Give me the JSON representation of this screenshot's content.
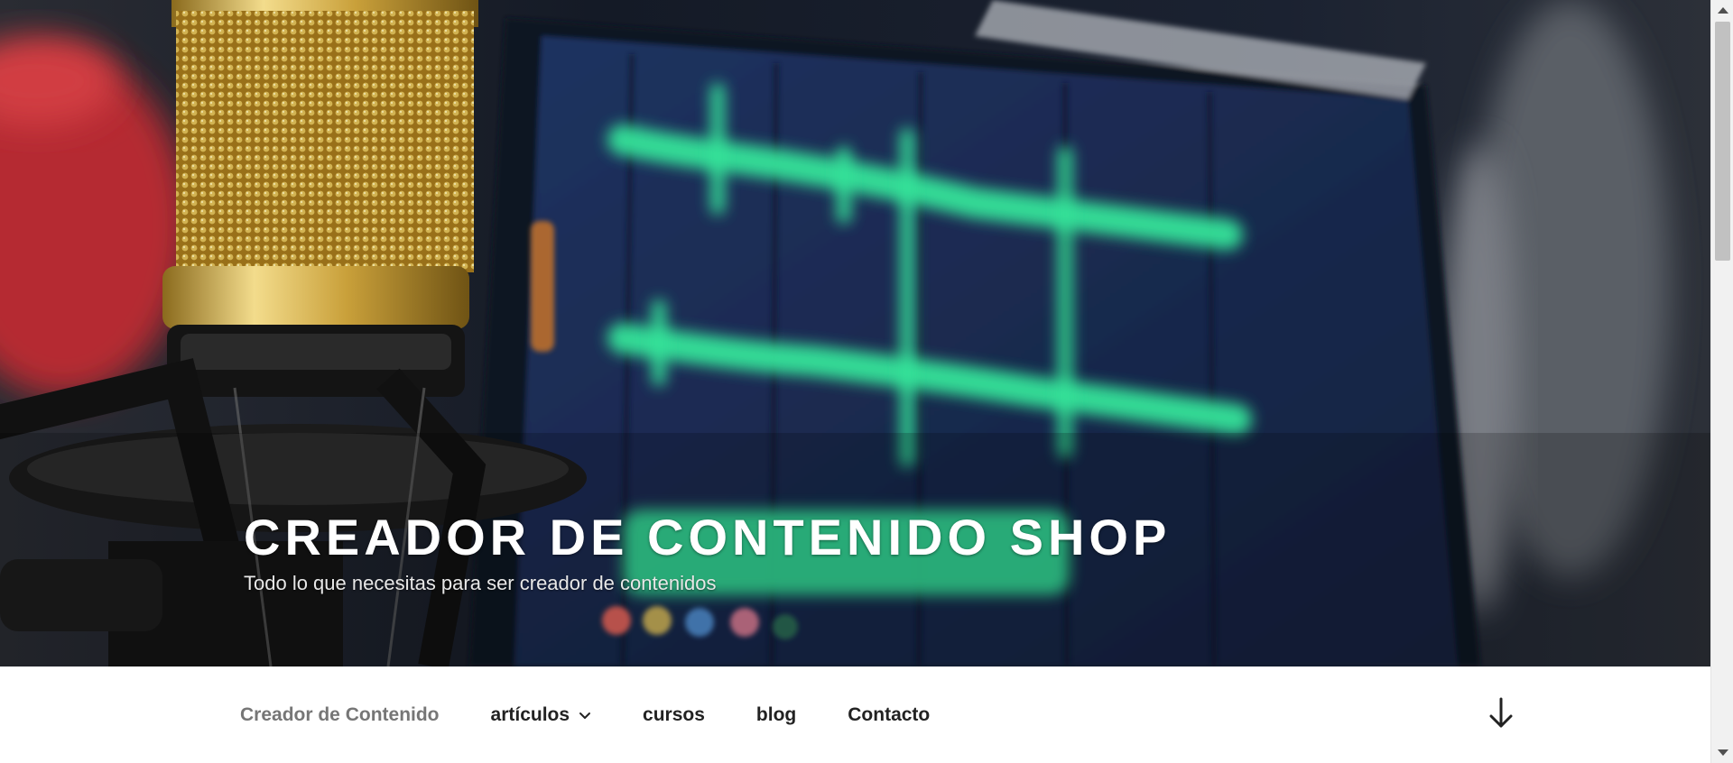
{
  "hero": {
    "image": "microphone-and-audio-waveform-monitor",
    "site_title": "CREADOR DE CONTENIDO SHOP",
    "site_description": "Todo lo que necesitas para ser creador de contenidos"
  },
  "nav": {
    "items": [
      {
        "label": "Creador de Contenido",
        "current": true
      },
      {
        "label": "artículos",
        "has_submenu": true
      },
      {
        "label": "cursos"
      },
      {
        "label": "blog"
      },
      {
        "label": "Contacto"
      }
    ],
    "scroll_icon": "arrow-down-icon"
  },
  "colors": {
    "waveform": "#35e39a",
    "mic_gold": "#c9a03a",
    "monitor": "#1b2a4a"
  }
}
